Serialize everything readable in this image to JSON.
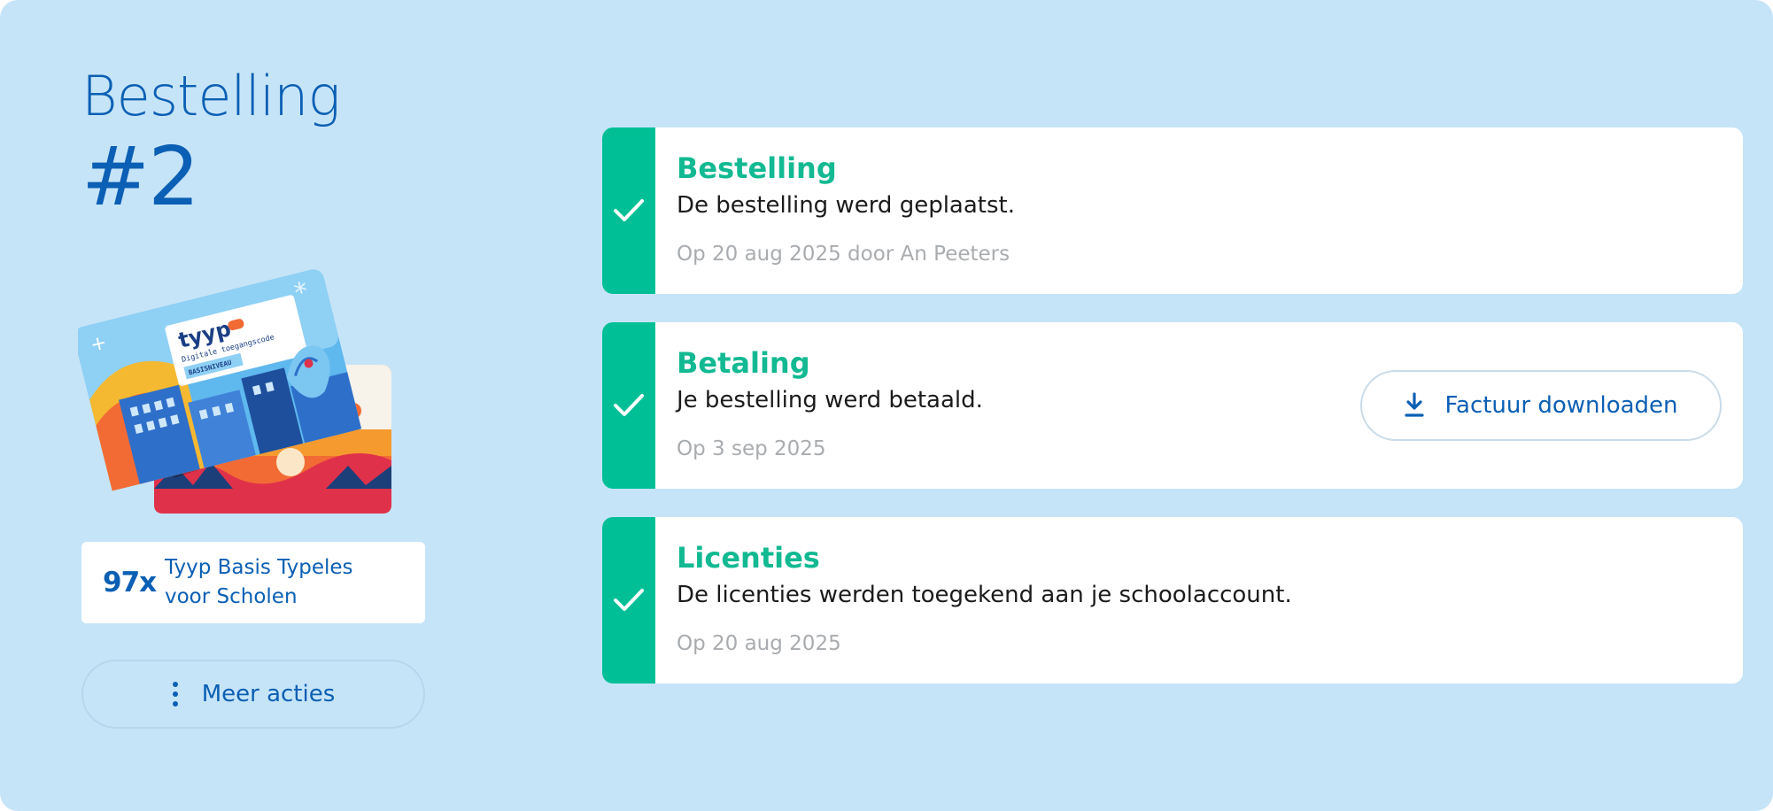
{
  "order": {
    "heading": "Bestelling",
    "number": "#2"
  },
  "product": {
    "quantity": "97x",
    "name": "Tyyp Basis Typeles voor Scholen",
    "image_brand": "tyyp",
    "image_subtitle": "Digitale toegangscode",
    "image_level": "BASISNIVEAU"
  },
  "actions": {
    "more_label": "Meer acties"
  },
  "steps": [
    {
      "title": "Bestelling",
      "description": "De bestelling werd geplaatst.",
      "meta": "Op 20 aug 2025 door An Peeters"
    },
    {
      "title": "Betaling",
      "description": "Je bestelling werd betaald.",
      "meta": "Op 3 sep 2025",
      "button_label": "Factuur downloaden"
    },
    {
      "title": "Licenties",
      "description": "De licenties werden toegekend aan je schoolaccount.",
      "meta": "Op 20 aug 2025"
    }
  ],
  "colors": {
    "background": "#c6e4f8",
    "primary": "#0b5fb4",
    "success": "#00bf96",
    "success_text": "#12b992",
    "muted": "#a9acaf"
  },
  "icons": {
    "step_status": "check-icon",
    "more": "kebab-icon",
    "invoice": "download-icon"
  }
}
